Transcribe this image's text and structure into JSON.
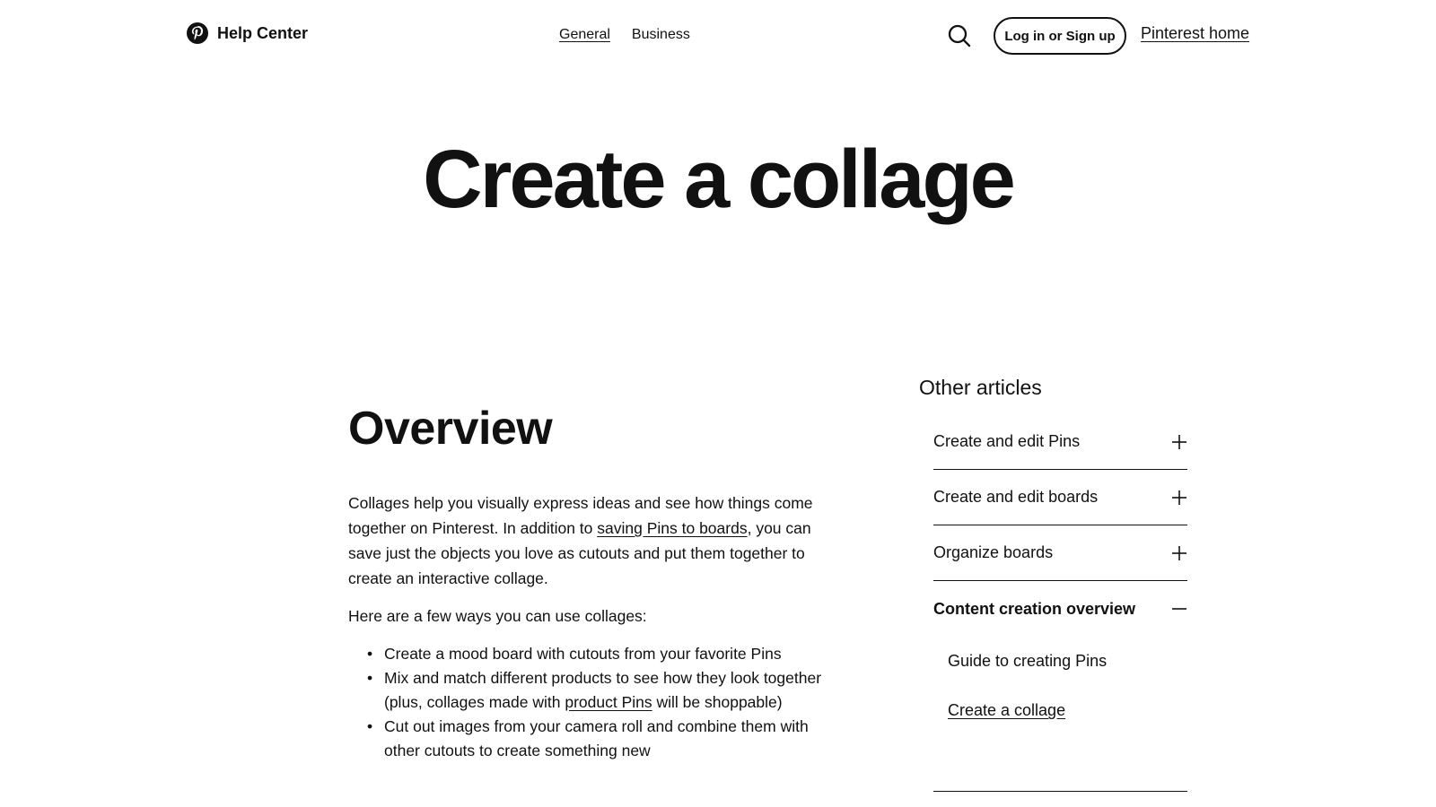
{
  "header": {
    "brand_name": "Help Center",
    "nav": [
      "General",
      "Business"
    ],
    "login_label": "Log in or Sign up",
    "home_link": "Pinterest home"
  },
  "hero": {
    "title": "Create a collage"
  },
  "article": {
    "section_title": "Overview",
    "p1_before": "Collages help you visually express ideas and see how things come together on Pinterest. In addition to ",
    "p1_link": "saving Pins to boards",
    "p1_after": ", you can save just the objects you love as cutouts and put them together to create an interactive collage.",
    "p2": "Here are a few ways you can use collages:",
    "bullets": [
      {
        "text": "Create a mood board with cutouts from your favorite Pins"
      },
      {
        "before": "Mix and match different products to see how they look together (plus, collages made with ",
        "link": "product Pins",
        "after": " will be shoppable)"
      },
      {
        "text": "Cut out images from your camera roll and combine them with other cutouts to create something new"
      }
    ]
  },
  "sidebar": {
    "heading": "Other articles",
    "items": [
      {
        "label": "Create and edit Pins",
        "icon": "plus-icon"
      },
      {
        "label": "Create and edit boards",
        "icon": "plus-icon"
      },
      {
        "label": "Organize boards",
        "icon": "plus-icon"
      },
      {
        "label": "Content creation overview",
        "icon": "minus-icon"
      }
    ],
    "sub_items": [
      "Guide to creating Pins",
      "Create a collage"
    ]
  },
  "colors": {
    "text": "#111111",
    "background": "#ffffff"
  }
}
